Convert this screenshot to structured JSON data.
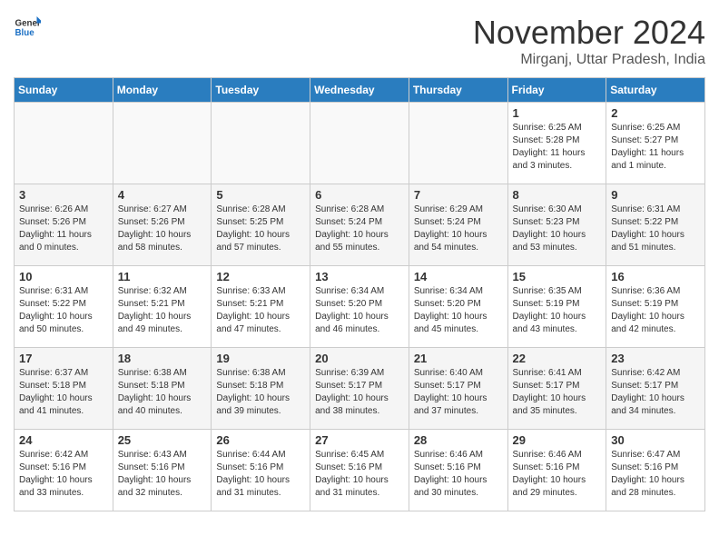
{
  "header": {
    "logo_general": "General",
    "logo_blue": "Blue",
    "month": "November 2024",
    "location": "Mirganj, Uttar Pradesh, India"
  },
  "weekdays": [
    "Sunday",
    "Monday",
    "Tuesday",
    "Wednesday",
    "Thursday",
    "Friday",
    "Saturday"
  ],
  "weeks": [
    [
      {
        "day": "",
        "info": ""
      },
      {
        "day": "",
        "info": ""
      },
      {
        "day": "",
        "info": ""
      },
      {
        "day": "",
        "info": ""
      },
      {
        "day": "",
        "info": ""
      },
      {
        "day": "1",
        "info": "Sunrise: 6:25 AM\nSunset: 5:28 PM\nDaylight: 11 hours\nand 3 minutes."
      },
      {
        "day": "2",
        "info": "Sunrise: 6:25 AM\nSunset: 5:27 PM\nDaylight: 11 hours\nand 1 minute."
      }
    ],
    [
      {
        "day": "3",
        "info": "Sunrise: 6:26 AM\nSunset: 5:26 PM\nDaylight: 11 hours\nand 0 minutes."
      },
      {
        "day": "4",
        "info": "Sunrise: 6:27 AM\nSunset: 5:26 PM\nDaylight: 10 hours\nand 58 minutes."
      },
      {
        "day": "5",
        "info": "Sunrise: 6:28 AM\nSunset: 5:25 PM\nDaylight: 10 hours\nand 57 minutes."
      },
      {
        "day": "6",
        "info": "Sunrise: 6:28 AM\nSunset: 5:24 PM\nDaylight: 10 hours\nand 55 minutes."
      },
      {
        "day": "7",
        "info": "Sunrise: 6:29 AM\nSunset: 5:24 PM\nDaylight: 10 hours\nand 54 minutes."
      },
      {
        "day": "8",
        "info": "Sunrise: 6:30 AM\nSunset: 5:23 PM\nDaylight: 10 hours\nand 53 minutes."
      },
      {
        "day": "9",
        "info": "Sunrise: 6:31 AM\nSunset: 5:22 PM\nDaylight: 10 hours\nand 51 minutes."
      }
    ],
    [
      {
        "day": "10",
        "info": "Sunrise: 6:31 AM\nSunset: 5:22 PM\nDaylight: 10 hours\nand 50 minutes."
      },
      {
        "day": "11",
        "info": "Sunrise: 6:32 AM\nSunset: 5:21 PM\nDaylight: 10 hours\nand 49 minutes."
      },
      {
        "day": "12",
        "info": "Sunrise: 6:33 AM\nSunset: 5:21 PM\nDaylight: 10 hours\nand 47 minutes."
      },
      {
        "day": "13",
        "info": "Sunrise: 6:34 AM\nSunset: 5:20 PM\nDaylight: 10 hours\nand 46 minutes."
      },
      {
        "day": "14",
        "info": "Sunrise: 6:34 AM\nSunset: 5:20 PM\nDaylight: 10 hours\nand 45 minutes."
      },
      {
        "day": "15",
        "info": "Sunrise: 6:35 AM\nSunset: 5:19 PM\nDaylight: 10 hours\nand 43 minutes."
      },
      {
        "day": "16",
        "info": "Sunrise: 6:36 AM\nSunset: 5:19 PM\nDaylight: 10 hours\nand 42 minutes."
      }
    ],
    [
      {
        "day": "17",
        "info": "Sunrise: 6:37 AM\nSunset: 5:18 PM\nDaylight: 10 hours\nand 41 minutes."
      },
      {
        "day": "18",
        "info": "Sunrise: 6:38 AM\nSunset: 5:18 PM\nDaylight: 10 hours\nand 40 minutes."
      },
      {
        "day": "19",
        "info": "Sunrise: 6:38 AM\nSunset: 5:18 PM\nDaylight: 10 hours\nand 39 minutes."
      },
      {
        "day": "20",
        "info": "Sunrise: 6:39 AM\nSunset: 5:17 PM\nDaylight: 10 hours\nand 38 minutes."
      },
      {
        "day": "21",
        "info": "Sunrise: 6:40 AM\nSunset: 5:17 PM\nDaylight: 10 hours\nand 37 minutes."
      },
      {
        "day": "22",
        "info": "Sunrise: 6:41 AM\nSunset: 5:17 PM\nDaylight: 10 hours\nand 35 minutes."
      },
      {
        "day": "23",
        "info": "Sunrise: 6:42 AM\nSunset: 5:17 PM\nDaylight: 10 hours\nand 34 minutes."
      }
    ],
    [
      {
        "day": "24",
        "info": "Sunrise: 6:42 AM\nSunset: 5:16 PM\nDaylight: 10 hours\nand 33 minutes."
      },
      {
        "day": "25",
        "info": "Sunrise: 6:43 AM\nSunset: 5:16 PM\nDaylight: 10 hours\nand 32 minutes."
      },
      {
        "day": "26",
        "info": "Sunrise: 6:44 AM\nSunset: 5:16 PM\nDaylight: 10 hours\nand 31 minutes."
      },
      {
        "day": "27",
        "info": "Sunrise: 6:45 AM\nSunset: 5:16 PM\nDaylight: 10 hours\nand 31 minutes."
      },
      {
        "day": "28",
        "info": "Sunrise: 6:46 AM\nSunset: 5:16 PM\nDaylight: 10 hours\nand 30 minutes."
      },
      {
        "day": "29",
        "info": "Sunrise: 6:46 AM\nSunset: 5:16 PM\nDaylight: 10 hours\nand 29 minutes."
      },
      {
        "day": "30",
        "info": "Sunrise: 6:47 AM\nSunset: 5:16 PM\nDaylight: 10 hours\nand 28 minutes."
      }
    ]
  ]
}
